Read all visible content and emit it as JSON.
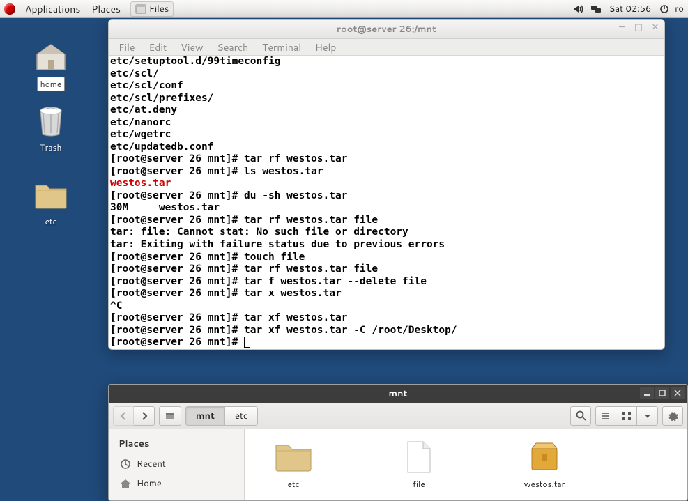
{
  "panel": {
    "menu_applications": "Applications",
    "menu_places": "Places",
    "task_files": "Files",
    "clock": "Sat 02:56",
    "user_snip": "ro"
  },
  "desktop": {
    "home": "home",
    "trash": "Trash",
    "etc": "etc"
  },
  "terminal": {
    "title": "root@server 26:/mnt",
    "menus": {
      "file": "File",
      "edit": "Edit",
      "view": "View",
      "search": "Search",
      "terminal": "Terminal",
      "help": "Help"
    },
    "lines": [
      "etc/setuptool.d/99timeconfig",
      "etc/scl/",
      "etc/scl/conf",
      "etc/scl/prefixes/",
      "etc/at.deny",
      "etc/nanorc",
      "etc/wgetrc",
      "etc/updatedb.conf",
      "[root@server 26 mnt]# tar rf westos.tar",
      "[root@server 26 mnt]# ls westos.tar"
    ],
    "red_line": "westos.tar",
    "lines2": [
      "[root@server 26 mnt]# du -sh westos.tar",
      "30M     westos.tar",
      "[root@server 26 mnt]# tar rf westos.tar file",
      "tar: file: Cannot stat: No such file or directory",
      "tar: Exiting with failure status due to previous errors",
      "[root@server 26 mnt]# touch file",
      "[root@server 26 mnt]# tar rf westos.tar file",
      "[root@server 26 mnt]# tar f westos.tar --delete file",
      "[root@server 26 mnt]# tar x westos.tar",
      "^C",
      "[root@server 26 mnt]# tar xf westos.tar",
      "[root@server 26 mnt]# tar xf westos.tar -C /root/Desktop/",
      "[root@server 26 mnt]# "
    ]
  },
  "filemanager": {
    "title": "mnt",
    "path": {
      "root": "mnt",
      "child": "etc"
    },
    "sidebar": {
      "heading": "Places",
      "recent": "Recent",
      "home": "Home"
    },
    "files": {
      "etc": "etc",
      "file": "file",
      "westos": "westos.tar"
    }
  }
}
